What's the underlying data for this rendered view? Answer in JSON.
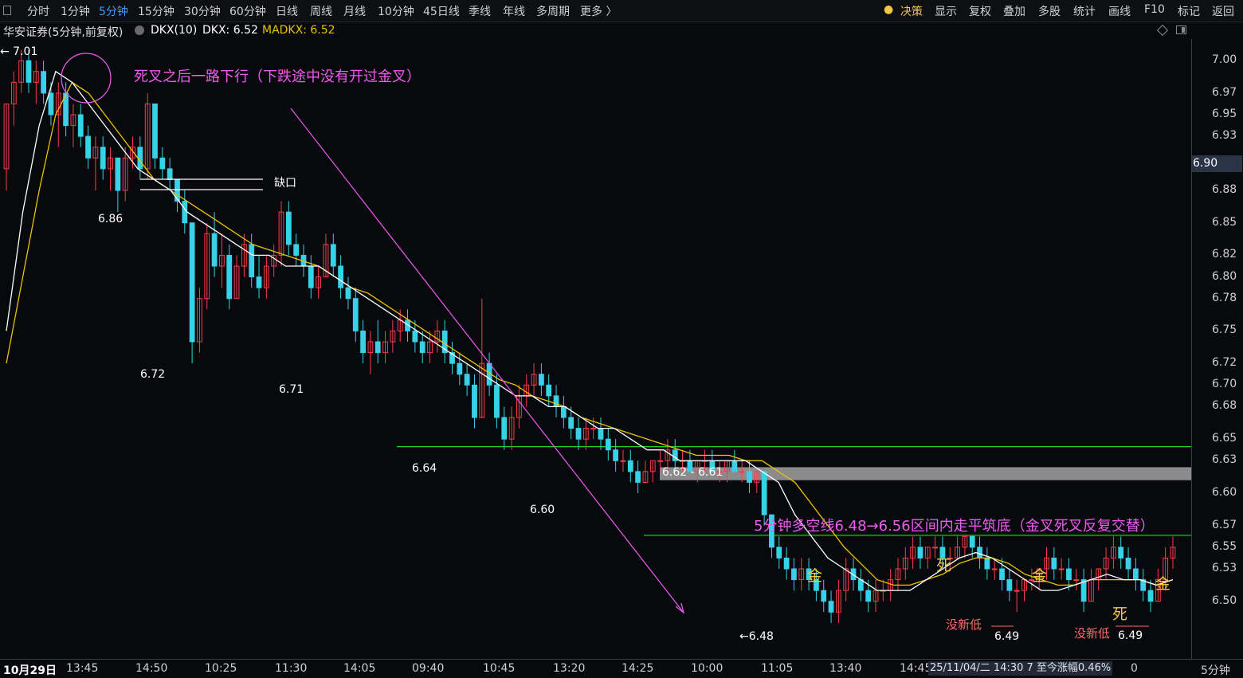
{
  "toolbar": {
    "periods": [
      "分时",
      "1分钟",
      "5分钟",
      "15分钟",
      "30分钟",
      "60分钟",
      "日线",
      "周线",
      "月线",
      "10分钟",
      "45日线",
      "季线",
      "年线",
      "多周期",
      "更多 〉"
    ],
    "active_period": "5分钟",
    "right_items": [
      "决策",
      "显示",
      "复权",
      "叠加",
      "多股",
      "统计",
      "画线",
      "F10",
      "标记",
      "返回"
    ]
  },
  "info": {
    "title": "华安证券(5分钟,前复权)",
    "dkx_label": "DKX(10)",
    "dkx_value": "DKX: 6.52",
    "madkx_value": "MADKX: 6.52"
  },
  "colors": {
    "up": "#ff3b4a",
    "down": "#37d1e8",
    "dkx": "#ffffff",
    "madkx": "#e9c400",
    "annotation": "#f05bf0",
    "level": "#1fd31f",
    "marker": "#f2c744"
  },
  "price_axis": {
    "ticks": [
      "7.00",
      "6.97",
      "6.95",
      "6.93",
      "6.90",
      "6.88",
      "6.85",
      "6.82",
      "6.80",
      "6.78",
      "6.75",
      "6.72",
      "6.70",
      "6.68",
      "6.65",
      "6.63",
      "6.60",
      "6.57",
      "6.55",
      "6.53",
      "6.50"
    ],
    "current": "6.90"
  },
  "time_axis": {
    "labels": [
      "10月29日",
      "13:45",
      "14:50",
      "10:25",
      "11:30",
      "14:05",
      "09:40",
      "10:45",
      "13:20",
      "14:25",
      "10:00",
      "11:05",
      "13:40",
      "14:45"
    ],
    "tail_label": "0",
    "right_label": "5分钟",
    "tooltip": "25/11/04/二 14:30 7 至今涨幅0.46%"
  },
  "chart_data": {
    "type": "candlestick",
    "ylim": [
      6.46,
      7.02
    ],
    "price_labels": [
      {
        "text": "← 7.01"
      },
      {
        "text": "6.86"
      },
      {
        "text": "6.72"
      },
      {
        "text": "6.71"
      },
      {
        "text": "6.64"
      },
      {
        "text": "6.60"
      },
      {
        "text": "6.62 - 6.61"
      },
      {
        "text": "←6.48"
      },
      {
        "text": "6.49"
      },
      {
        "text": "6.49"
      }
    ],
    "annotations": {
      "death_cross_note": "死叉之后一路下行（下跌途中没有开过金叉）",
      "gap_label": "缺口",
      "range_note": "5分钟多空线6.48→6.56区间内走平筑底（金叉死叉反复交替）",
      "gold_mark": "金",
      "death_mark": "死",
      "no_new_low": "没新低"
    },
    "levels": [
      {
        "name": "support-6.64",
        "value": 6.643
      },
      {
        "name": "gap-zone",
        "low": 6.612,
        "high": 6.624
      },
      {
        "name": "range-top",
        "value": 6.561
      }
    ],
    "candles": [
      [
        6.9,
        6.96,
        6.88,
        6.96
      ],
      [
        6.96,
        6.99,
        6.94,
        6.98
      ],
      [
        6.98,
        7.01,
        6.97,
        7.0
      ],
      [
        7.0,
        7.01,
        6.97,
        6.98
      ],
      [
        6.98,
        7.0,
        6.96,
        6.99
      ],
      [
        6.99,
        7.0,
        6.96,
        6.97
      ],
      [
        6.97,
        6.98,
        6.94,
        6.95
      ],
      [
        6.95,
        6.98,
        6.92,
        6.97
      ],
      [
        6.97,
        6.98,
        6.93,
        6.94
      ],
      [
        6.94,
        6.96,
        6.92,
        6.95
      ],
      [
        6.95,
        6.96,
        6.92,
        6.93
      ],
      [
        6.93,
        6.94,
        6.9,
        6.91
      ],
      [
        6.91,
        6.93,
        6.88,
        6.92
      ],
      [
        6.92,
        6.93,
        6.89,
        6.9
      ],
      [
        6.9,
        6.92,
        6.88,
        6.91
      ],
      [
        6.91,
        6.91,
        6.86,
        6.88
      ],
      [
        6.88,
        6.92,
        6.87,
        6.91
      ],
      [
        6.91,
        6.93,
        6.9,
        6.92
      ],
      [
        6.92,
        6.93,
        6.89,
        6.9
      ],
      [
        6.9,
        6.97,
        6.89,
        6.96
      ],
      [
        6.96,
        6.96,
        6.9,
        6.91
      ],
      [
        6.91,
        6.92,
        6.89,
        6.9
      ],
      [
        6.9,
        6.91,
        6.88,
        6.89
      ],
      [
        6.89,
        6.89,
        6.86,
        6.87
      ],
      [
        6.87,
        6.88,
        6.84,
        6.85
      ],
      [
        6.85,
        6.85,
        6.72,
        6.74
      ],
      [
        6.74,
        6.79,
        6.73,
        6.78
      ],
      [
        6.78,
        6.85,
        6.77,
        6.84
      ],
      [
        6.84,
        6.86,
        6.8,
        6.81
      ],
      [
        6.81,
        6.84,
        6.79,
        6.82
      ],
      [
        6.82,
        6.83,
        6.77,
        6.78
      ],
      [
        6.78,
        6.82,
        6.78,
        6.81
      ],
      [
        6.81,
        6.84,
        6.8,
        6.83
      ],
      [
        6.83,
        6.84,
        6.79,
        6.8
      ],
      [
        6.8,
        6.82,
        6.78,
        6.79
      ],
      [
        6.79,
        6.82,
        6.78,
        6.81
      ],
      [
        6.81,
        6.83,
        6.8,
        6.82
      ],
      [
        6.82,
        6.87,
        6.81,
        6.86
      ],
      [
        6.86,
        6.87,
        6.82,
        6.83
      ],
      [
        6.83,
        6.84,
        6.81,
        6.82
      ],
      [
        6.82,
        6.83,
        6.8,
        6.81
      ],
      [
        6.81,
        6.82,
        6.78,
        6.79
      ],
      [
        6.79,
        6.81,
        6.78,
        6.8
      ],
      [
        6.8,
        6.84,
        6.8,
        6.83
      ],
      [
        6.83,
        6.84,
        6.8,
        6.81
      ],
      [
        6.81,
        6.82,
        6.78,
        6.79
      ],
      [
        6.79,
        6.8,
        6.77,
        6.78
      ],
      [
        6.78,
        6.79,
        6.74,
        6.75
      ],
      [
        6.75,
        6.76,
        6.72,
        6.73
      ],
      [
        6.73,
        6.75,
        6.71,
        6.74
      ],
      [
        6.74,
        6.76,
        6.72,
        6.73
      ],
      [
        6.73,
        6.75,
        6.72,
        6.74
      ],
      [
        6.74,
        6.76,
        6.73,
        6.75
      ],
      [
        6.75,
        6.77,
        6.74,
        6.76
      ],
      [
        6.76,
        6.77,
        6.74,
        6.75
      ],
      [
        6.75,
        6.76,
        6.73,
        6.74
      ],
      [
        6.74,
        6.75,
        6.72,
        6.73
      ],
      [
        6.73,
        6.75,
        6.72,
        6.74
      ],
      [
        6.74,
        6.76,
        6.73,
        6.75
      ],
      [
        6.75,
        6.76,
        6.72,
        6.73
      ],
      [
        6.73,
        6.74,
        6.71,
        6.72
      ],
      [
        6.72,
        6.73,
        6.7,
        6.71
      ],
      [
        6.71,
        6.72,
        6.69,
        6.7
      ],
      [
        6.7,
        6.71,
        6.66,
        6.67
      ],
      [
        6.67,
        6.78,
        6.67,
        6.72
      ],
      [
        6.72,
        6.73,
        6.69,
        6.7
      ],
      [
        6.7,
        6.71,
        6.66,
        6.67
      ],
      [
        6.67,
        6.68,
        6.64,
        6.65
      ],
      [
        6.65,
        6.68,
        6.64,
        6.67
      ],
      [
        6.67,
        6.7,
        6.66,
        6.69
      ],
      [
        6.69,
        6.71,
        6.68,
        6.7
      ],
      [
        6.7,
        6.72,
        6.69,
        6.71
      ],
      [
        6.71,
        6.72,
        6.69,
        6.7
      ],
      [
        6.7,
        6.71,
        6.68,
        6.69
      ],
      [
        6.69,
        6.7,
        6.67,
        6.68
      ],
      [
        6.68,
        6.69,
        6.66,
        6.67
      ],
      [
        6.67,
        6.68,
        6.65,
        6.66
      ],
      [
        6.66,
        6.67,
        6.64,
        6.65
      ],
      [
        6.65,
        6.67,
        6.64,
        6.66
      ],
      [
        6.66,
        6.67,
        6.65,
        6.66
      ],
      [
        6.66,
        6.67,
        6.64,
        6.65
      ],
      [
        6.65,
        6.66,
        6.63,
        6.64
      ],
      [
        6.64,
        6.65,
        6.62,
        6.63
      ],
      [
        6.63,
        6.64,
        6.62,
        6.63
      ],
      [
        6.63,
        6.64,
        6.61,
        6.62
      ],
      [
        6.62,
        6.63,
        6.6,
        6.61
      ],
      [
        6.61,
        6.63,
        6.61,
        6.62
      ],
      [
        6.62,
        6.63,
        6.61,
        6.63
      ],
      [
        6.63,
        6.64,
        6.62,
        6.63
      ],
      [
        6.63,
        6.65,
        6.62,
        6.64
      ],
      [
        6.64,
        6.65,
        6.62,
        6.63
      ],
      [
        6.63,
        6.64,
        6.62,
        6.63
      ],
      [
        6.63,
        6.64,
        6.62,
        6.62
      ],
      [
        6.62,
        6.63,
        6.61,
        6.63
      ],
      [
        6.63,
        6.64,
        6.62,
        6.63
      ],
      [
        6.63,
        6.64,
        6.62,
        6.62
      ],
      [
        6.62,
        6.63,
        6.61,
        6.62
      ],
      [
        6.62,
        6.63,
        6.61,
        6.63
      ],
      [
        6.63,
        6.64,
        6.62,
        6.62
      ],
      [
        6.62,
        6.63,
        6.61,
        6.62
      ],
      [
        6.62,
        6.63,
        6.6,
        6.61
      ],
      [
        6.61,
        6.62,
        6.6,
        6.62
      ],
      [
        6.62,
        6.62,
        6.57,
        6.58
      ],
      [
        6.58,
        6.58,
        6.54,
        6.55
      ],
      [
        6.55,
        6.56,
        6.53,
        6.54
      ],
      [
        6.54,
        6.55,
        6.52,
        6.53
      ],
      [
        6.53,
        6.54,
        6.51,
        6.52
      ],
      [
        6.52,
        6.54,
        6.51,
        6.53
      ],
      [
        6.53,
        6.54,
        6.51,
        6.52
      ],
      [
        6.52,
        6.53,
        6.5,
        6.51
      ],
      [
        6.51,
        6.52,
        6.49,
        6.5
      ],
      [
        6.5,
        6.51,
        6.48,
        6.49
      ],
      [
        6.49,
        6.52,
        6.48,
        6.51
      ],
      [
        6.51,
        6.54,
        6.5,
        6.53
      ],
      [
        6.53,
        6.54,
        6.51,
        6.52
      ],
      [
        6.52,
        6.53,
        6.5,
        6.51
      ],
      [
        6.51,
        6.52,
        6.49,
        6.5
      ],
      [
        6.5,
        6.52,
        6.49,
        6.51
      ],
      [
        6.51,
        6.52,
        6.5,
        6.51
      ],
      [
        6.51,
        6.53,
        6.5,
        6.52
      ],
      [
        6.52,
        6.54,
        6.51,
        6.53
      ],
      [
        6.53,
        6.55,
        6.52,
        6.54
      ],
      [
        6.54,
        6.56,
        6.53,
        6.55
      ],
      [
        6.55,
        6.56,
        6.53,
        6.54
      ],
      [
        6.54,
        6.55,
        6.53,
        6.55
      ],
      [
        6.55,
        6.56,
        6.54,
        6.55
      ],
      [
        6.55,
        6.56,
        6.53,
        6.54
      ],
      [
        6.54,
        6.55,
        6.53,
        6.54
      ],
      [
        6.54,
        6.56,
        6.54,
        6.55
      ],
      [
        6.55,
        6.56,
        6.54,
        6.56
      ],
      [
        6.56,
        6.56,
        6.54,
        6.55
      ],
      [
        6.55,
        6.56,
        6.53,
        6.54
      ],
      [
        6.54,
        6.55,
        6.52,
        6.53
      ],
      [
        6.53,
        6.54,
        6.52,
        6.53
      ],
      [
        6.53,
        6.54,
        6.51,
        6.52
      ],
      [
        6.52,
        6.53,
        6.5,
        6.51
      ],
      [
        6.51,
        6.52,
        6.49,
        6.51
      ],
      [
        6.51,
        6.52,
        6.5,
        6.52
      ],
      [
        6.52,
        6.53,
        6.51,
        6.52
      ],
      [
        6.52,
        6.53,
        6.51,
        6.53
      ],
      [
        6.53,
        6.55,
        6.52,
        6.54
      ],
      [
        6.54,
        6.55,
        6.52,
        6.53
      ],
      [
        6.53,
        6.54,
        6.52,
        6.53
      ],
      [
        6.53,
        6.54,
        6.51,
        6.52
      ],
      [
        6.52,
        6.53,
        6.51,
        6.52
      ],
      [
        6.52,
        6.53,
        6.49,
        6.5
      ],
      [
        6.5,
        6.53,
        6.5,
        6.52
      ],
      [
        6.52,
        6.53,
        6.51,
        6.53
      ],
      [
        6.53,
        6.55,
        6.52,
        6.54
      ],
      [
        6.54,
        6.56,
        6.53,
        6.55
      ],
      [
        6.55,
        6.56,
        6.53,
        6.54
      ],
      [
        6.54,
        6.55,
        6.52,
        6.53
      ],
      [
        6.53,
        6.54,
        6.51,
        6.52
      ],
      [
        6.52,
        6.53,
        6.5,
        6.51
      ],
      [
        6.51,
        6.52,
        6.49,
        6.5
      ],
      [
        6.5,
        6.53,
        6.5,
        6.52
      ],
      [
        6.52,
        6.55,
        6.51,
        6.54
      ],
      [
        6.54,
        6.56,
        6.53,
        6.55
      ]
    ],
    "dkx_line": [
      6.75,
      6.86,
      6.94,
      6.99,
      6.98,
      6.96,
      6.94,
      6.92,
      6.9,
      6.89,
      6.88,
      6.86,
      6.85,
      6.84,
      6.83,
      6.82,
      6.82,
      6.81,
      6.81,
      6.81,
      6.8,
      6.79,
      6.78,
      6.77,
      6.76,
      6.75,
      6.74,
      6.73,
      6.72,
      6.71,
      6.7,
      6.69,
      6.69,
      6.68,
      6.68,
      6.67,
      6.66,
      6.66,
      6.65,
      6.64,
      6.64,
      6.63,
      6.63,
      6.63,
      6.63,
      6.63,
      6.62,
      6.61,
      6.58,
      6.56,
      6.54,
      6.53,
      6.52,
      6.51,
      6.51,
      6.51,
      6.52,
      6.53,
      6.54,
      6.545,
      6.54,
      6.53,
      6.52,
      6.51,
      6.51,
      6.515,
      6.52,
      6.525,
      6.52,
      6.52,
      6.515,
      6.52
    ],
    "madkx_line": [
      6.72,
      6.8,
      6.88,
      6.95,
      6.98,
      6.97,
      6.95,
      6.93,
      6.91,
      6.89,
      6.88,
      6.87,
      6.86,
      6.85,
      6.84,
      6.83,
      6.825,
      6.82,
      6.815,
      6.81,
      6.8,
      6.79,
      6.785,
      6.775,
      6.765,
      6.755,
      6.745,
      6.735,
      6.725,
      6.715,
      6.705,
      6.7,
      6.69,
      6.685,
      6.68,
      6.67,
      6.665,
      6.66,
      6.655,
      6.65,
      6.645,
      6.64,
      6.635,
      6.635,
      6.635,
      6.63,
      6.63,
      6.62,
      6.61,
      6.59,
      6.57,
      6.55,
      6.535,
      6.52,
      6.515,
      6.515,
      6.52,
      6.525,
      6.535,
      6.54,
      6.54,
      6.535,
      6.525,
      6.52,
      6.515,
      6.515,
      6.52,
      6.52,
      6.52,
      6.52,
      6.515,
      6.52
    ]
  }
}
